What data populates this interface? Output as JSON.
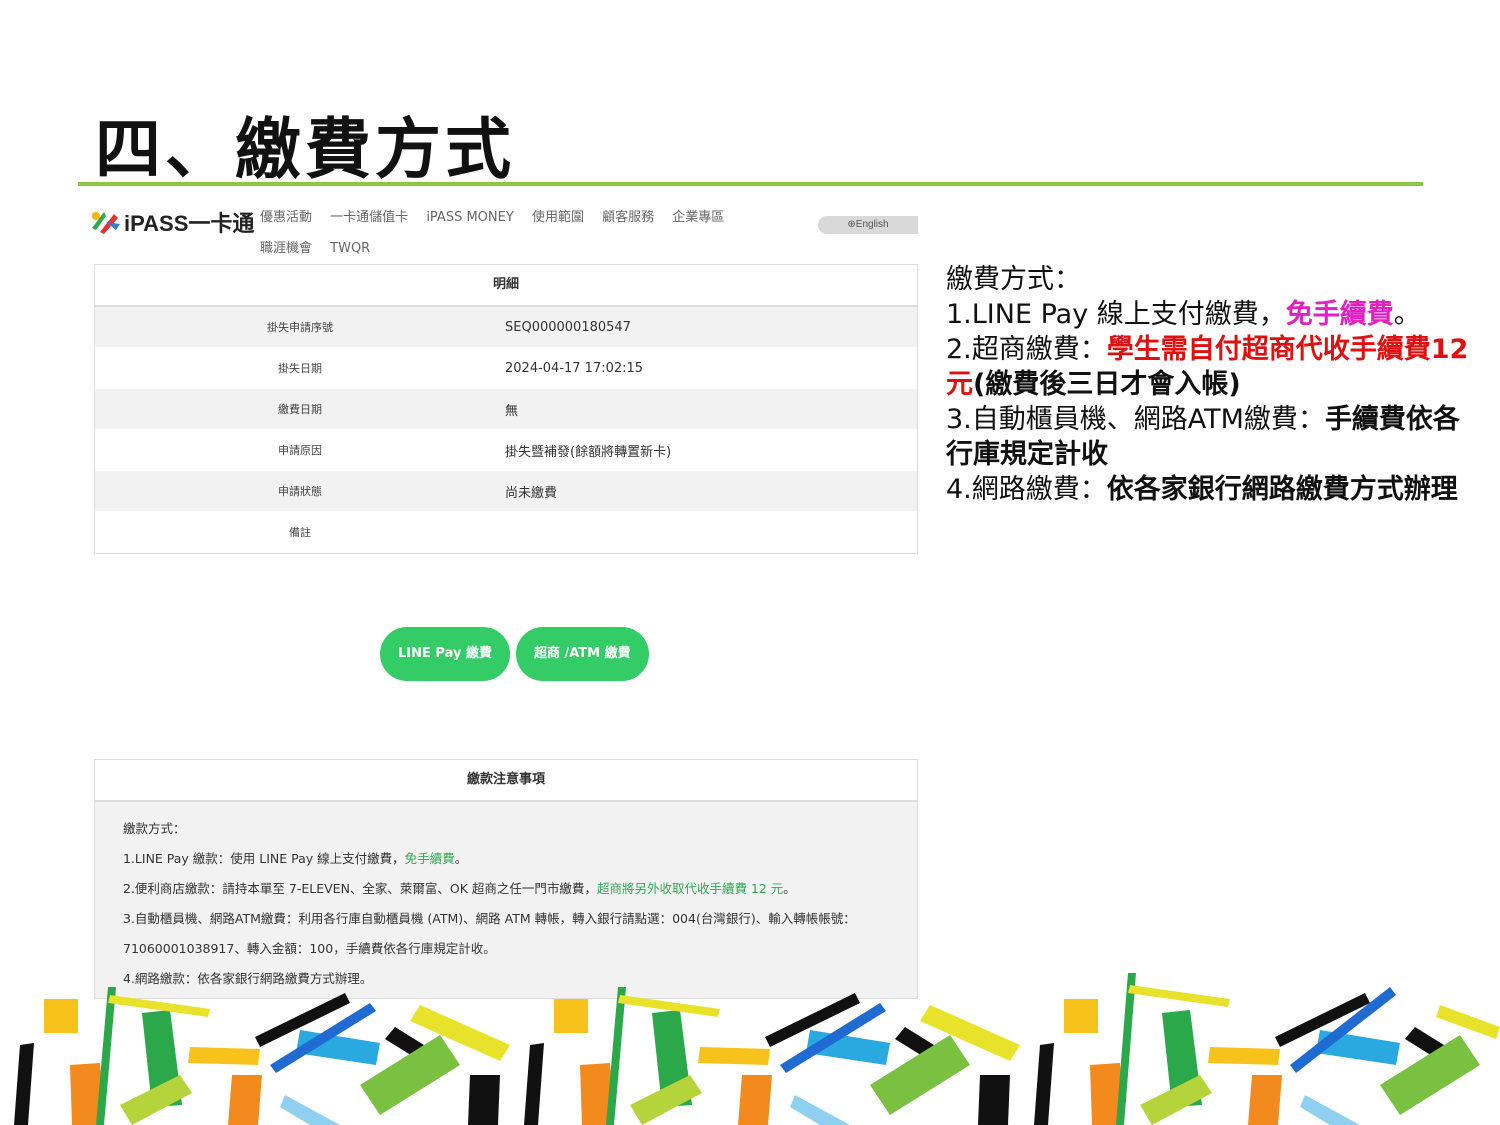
{
  "slide": {
    "title": "四、繳費方式"
  },
  "screenshot": {
    "logo_text": "iPASS一卡通",
    "nav": [
      "優惠活動",
      "一卡通儲值卡",
      "iPASS MONEY",
      "使用範圍",
      "顧客服務",
      "企業專區",
      "職涯機會",
      "TWQR"
    ],
    "lang": "English",
    "detail": {
      "header": "明細",
      "rows": [
        {
          "label": "掛失申請序號",
          "value": "SEQ000000180547"
        },
        {
          "label": "掛失日期",
          "value": "2024-04-17 17:02:15"
        },
        {
          "label": "繳費日期",
          "value": "無"
        },
        {
          "label": "申請原因",
          "value": "掛失暨補發(餘額將轉置新卡)"
        },
        {
          "label": "申請狀態",
          "value": "尚未繳費"
        },
        {
          "label": "備註",
          "value": ""
        }
      ]
    },
    "buttons": {
      "linepay": "LINE Pay 繳費",
      "store_atm": "超商 /ATM 繳費"
    },
    "notice": {
      "header": "繳款注意事項",
      "intro": "繳款方式：",
      "l1": "1.LINE Pay 繳款：使用 LINE Pay 線上支付繳費，",
      "l1_green": "免手續費",
      "l1_end": "。",
      "l2": "2.便利商店繳款：請持本單至 7-ELEVEN、全家、萊爾富、OK 超商之任一門市繳費，",
      "l2_green": "超商將另外收取代收手續費 12 元",
      "l2_end": "。",
      "l3": "3.自動櫃員機、網路ATM繳費：利用各行庫自動櫃員機 (ATM)、網路 ATM 轉帳，轉入銀行請點選：004(台灣銀行)、輸入轉帳帳號：",
      "l3b": "71060001038917、轉入金額：100，手續費依各行庫規定計收。",
      "l4": "4.網路繳款：依各家銀行網路繳費方式辦理。"
    }
  },
  "side": {
    "heading": "繳費方式：",
    "i1_a": "1.LINE Pay 線上支付繳費，",
    "i1_b": "免手續費",
    "i1_c": "。",
    "i2_a": "2.超商繳費：",
    "i2_b": "學生需自付超商代收手續費12元",
    "i2_c": "(繳費後三日才會入帳)",
    "i3_a": "3.自動櫃員機、網路ATM繳費：",
    "i3_b": "手續費依各行庫規定計收",
    "i4_a": "4.網路繳費：",
    "i4_b": "依各家銀行網路繳費方式辦理"
  },
  "colors": {
    "accent_green": "#8cc63f",
    "button_green": "#33cc66",
    "pink": "#e020c0",
    "red": "#e01010"
  }
}
